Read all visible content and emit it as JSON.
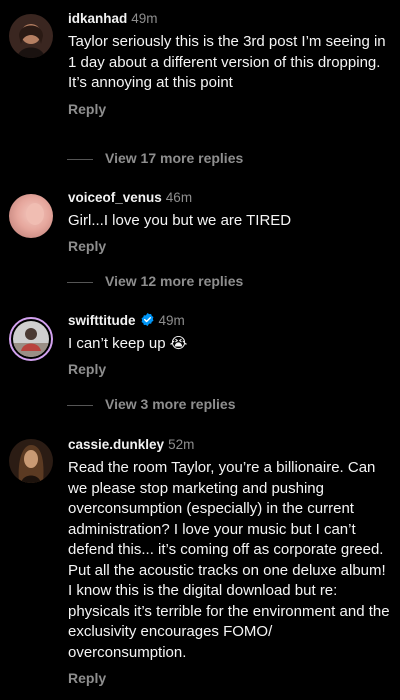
{
  "comments": [
    {
      "username": "idkanhad",
      "time": "49m",
      "verified": false,
      "text": "Taylor seriously this is the 3rd post I’m seeing in 1 day about a different version of this dropping. It’s annoying at this point",
      "reply_label": "Reply",
      "view_replies": "View 17 more replies"
    },
    {
      "username": "voiceof_venus",
      "time": "46m",
      "verified": false,
      "text": "Girl...I love you but we are TIRED",
      "reply_label": "Reply",
      "view_replies": "View 12 more replies"
    },
    {
      "username": "swifttitude",
      "time": "49m",
      "verified": true,
      "text": "I can’t keep up 😭",
      "reply_label": "Reply",
      "view_replies": "View 3 more replies"
    },
    {
      "username": "cassie.dunkley",
      "time": "52m",
      "verified": false,
      "text": "Read the room Taylor, you’re a billionaire. Can we please stop marketing and pushing overconsumption (especially) in the current administration? I love your music but I can’t defend this... it’s coming off as corporate greed. Put all the acoustic tracks on one deluxe album! I know this is the digital download but re: physicals it’s terrible for the environment and the exclusivity encourages FOMO/ overconsumption.",
      "reply_label": "Reply"
    }
  ],
  "colors": {
    "background": "#000000",
    "text_primary": "#f5f5f5",
    "text_secondary": "#8e8e8e",
    "verified_blue": "#0095f6",
    "story_ring": "#d3a2f0"
  }
}
